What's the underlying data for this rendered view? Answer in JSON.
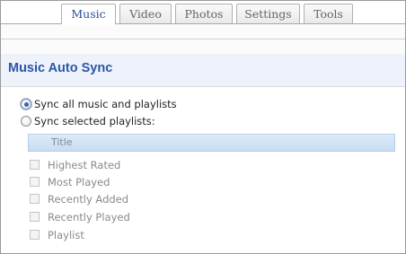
{
  "tabs": [
    {
      "label": "Music",
      "active": true
    },
    {
      "label": "Video",
      "active": false
    },
    {
      "label": "Photos",
      "active": false
    },
    {
      "label": "Settings",
      "active": false
    },
    {
      "label": "Tools",
      "active": false
    }
  ],
  "section": {
    "title": "Music Auto Sync"
  },
  "sync_options": [
    {
      "label": "Sync all music and playlists",
      "selected": true
    },
    {
      "label": "Sync selected playlists:",
      "selected": false
    }
  ],
  "playlist_table": {
    "column_header": "Title",
    "rows": [
      {
        "label": "Highest Rated",
        "checked": false
      },
      {
        "label": "Most Played",
        "checked": false
      },
      {
        "label": "Recently Added",
        "checked": false
      },
      {
        "label": "Recently Played",
        "checked": false
      },
      {
        "label": "Playlist",
        "checked": false
      }
    ]
  },
  "colors": {
    "accent": "#2d55a7",
    "active_tab_text": "#2a4e9a",
    "disabled_text": "#8a8a8a"
  }
}
